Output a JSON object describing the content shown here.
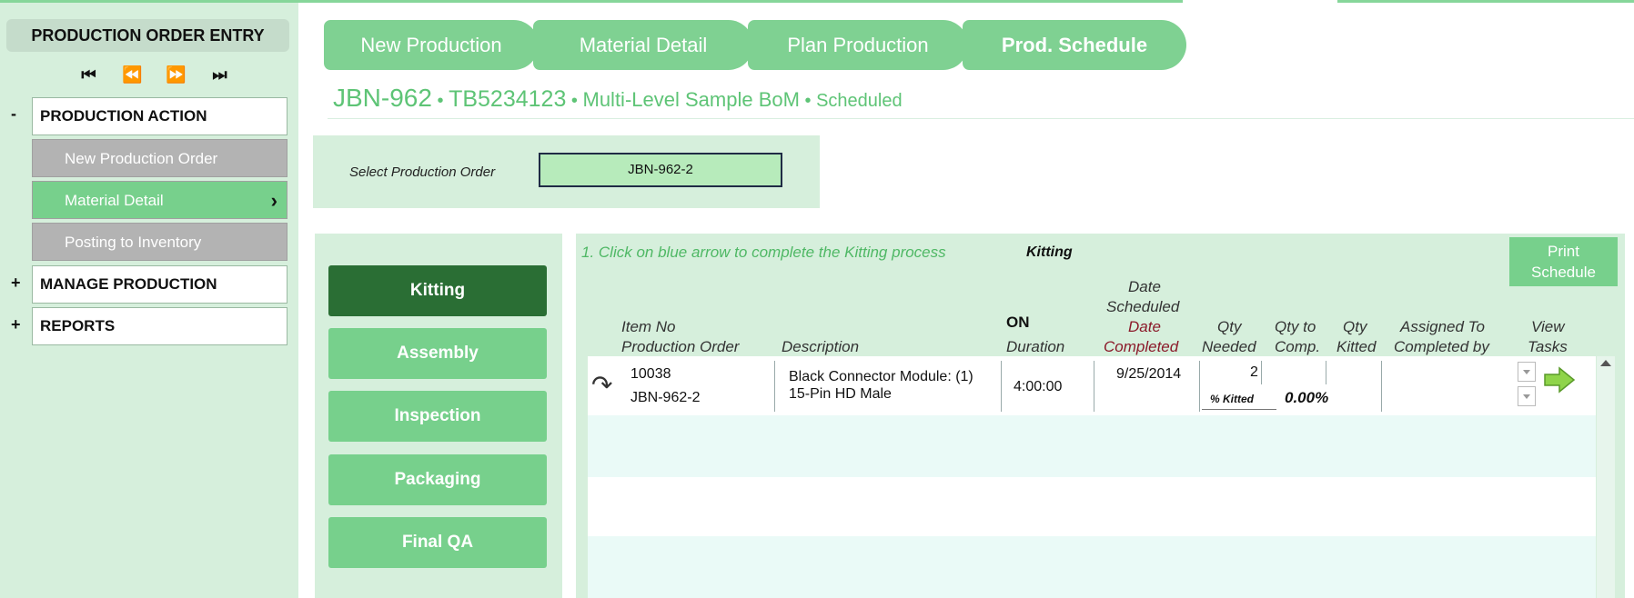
{
  "sidebar": {
    "title": "PRODUCTION ORDER ENTRY",
    "nav": {
      "first": "⏮",
      "prev": "⏪",
      "next": "⏩",
      "last": "⏭"
    },
    "sections": [
      {
        "sign": "-",
        "label": "PRODUCTION ACTION"
      },
      {
        "sign": "+",
        "label": "MANAGE PRODUCTION"
      },
      {
        "sign": "+",
        "label": "REPORTS"
      }
    ],
    "sub_items": [
      {
        "label": "New Production Order"
      },
      {
        "label": "Material Detail",
        "chevron": "›"
      },
      {
        "label": "Posting to Inventory"
      }
    ]
  },
  "tabs": [
    {
      "label": "New Production"
    },
    {
      "label": "Material Detail"
    },
    {
      "label": "Plan Production"
    },
    {
      "label": "Prod. Schedule"
    }
  ],
  "header": {
    "order_no": "JBN-962",
    "sep": "•",
    "item_code": "TB5234123",
    "bom": "Multi-Level Sample BoM",
    "status": "Scheduled"
  },
  "select_order": {
    "label": "Select Production Order",
    "value": "JBN-962-2"
  },
  "steps": [
    {
      "label": "Kitting"
    },
    {
      "label": "Assembly"
    },
    {
      "label": "Inspection"
    },
    {
      "label": "Packaging"
    },
    {
      "label": "Final QA"
    }
  ],
  "schedule": {
    "instruction": "1. Click on blue arrow to complete the Kitting  process",
    "current_step": "Kitting",
    "print_label_1": "Print",
    "print_label_2": "Schedule",
    "headers": {
      "item_no": "Item No",
      "prod_order": "Production Order",
      "description": "Description",
      "on": "ON",
      "duration": "Duration",
      "date": "Date",
      "scheduled": "Scheduled",
      "date_red": "Date",
      "completed_red": "Completed",
      "qty1": "Qty",
      "needed": "Needed",
      "qty_to": "Qty to",
      "comp": "Comp.",
      "qty2": "Qty",
      "kitted": "Kitted",
      "assigned_to": "Assigned To",
      "completed_by": "Completed by",
      "view": "View",
      "tasks": "Tasks"
    },
    "row": {
      "item_no": "10038",
      "prod_order": "JBN-962-2",
      "desc_line1": "Black Connector Module:  (1)",
      "desc_line2": "15-Pin HD Male",
      "duration": "4:00:00",
      "date_scheduled": "9/25/2014",
      "qty_needed": "2",
      "pct_kitted_label": "% Kitted",
      "pct_kitted": "0.00%"
    },
    "colors": {
      "accent": "#77d08c",
      "dark": "#2a6e34",
      "panel": "#d6efdc"
    }
  }
}
